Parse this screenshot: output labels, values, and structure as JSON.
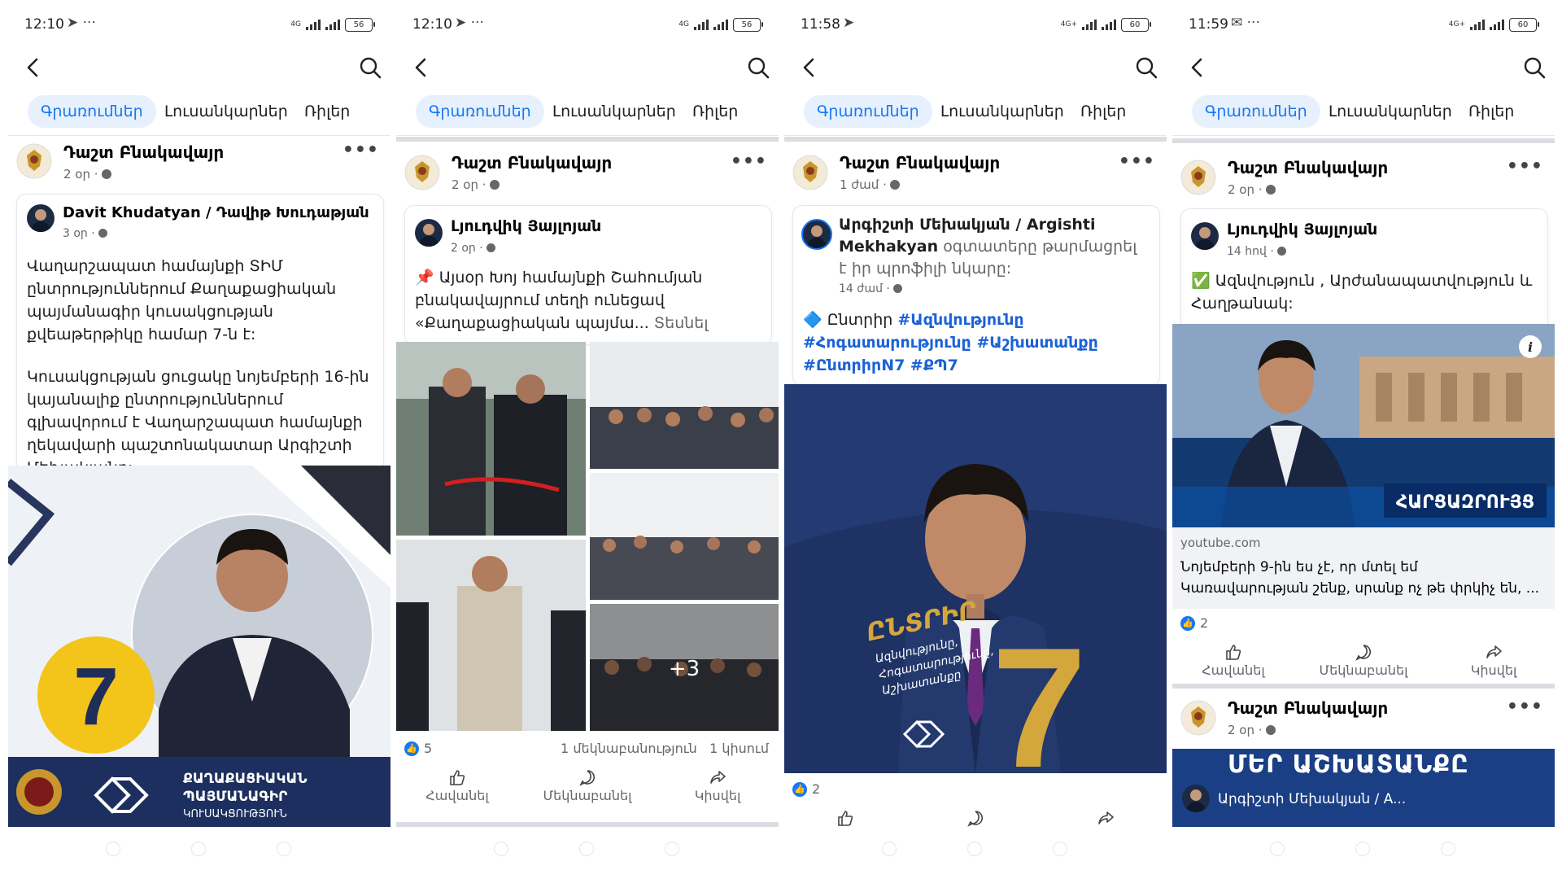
{
  "colors": {
    "accent": "#1877f2",
    "accent_bg": "#e7f0fd",
    "text": "#050505",
    "meta": "#65676b",
    "navy": "#1c2f5e",
    "gold": "#f1c40f"
  },
  "icons": [
    "back-icon",
    "search-icon",
    "globe-icon",
    "like-icon",
    "comment-icon",
    "share-icon",
    "more-icon"
  ],
  "tabs": [
    "Գրառումներ",
    "Լուսանկարներ",
    "Ռիլեր"
  ],
  "actions": [
    "Հավանել",
    "Մեկնաբանել",
    "Կիսվել"
  ],
  "page_name": "Դաշտ Բնակավայր",
  "screens": [
    {
      "status": {
        "time": "12:10",
        "extra": "➤ ···",
        "net": "4G",
        "battery": "56"
      },
      "post": {
        "meta": "2 օր ·",
        "shared_author": "Davit Khudatyan / Դավիթ Խուդաթյան",
        "shared_meta": "3 օր ·",
        "text_1": "Վաղարշապատ համայնքի ՏԻՄ ընտրություններում Քաղաքացիական պայմանագիր կուսակցության քվեաթերթիկը համար 7-ն է:",
        "text_2": "Կուսակցության ցուցակը նոյեմբերի 16-ին կայանալիք ընտրություններում գլխավորում է Վաղարշապատ համայնքի ղեկավարի պաշտոնակատար Արգիշտի Մեխակյանը:",
        "image_number": "7",
        "banner_line1": "ՔԱՂԱՔԱՑԻԱԿԱՆ",
        "banner_line2": "ՊԱՅՄԱՆԱԳԻՐ",
        "banner_line3": "ԿՈՒՍԱԿՑՈՒԹՅՈՒՆ"
      }
    },
    {
      "status": {
        "time": "12:10",
        "extra": "➤ ···",
        "net": "4G",
        "battery": "56"
      },
      "post": {
        "meta": "2 օր ·",
        "shared_author": "Լյուդվիկ Յայլոյան",
        "shared_meta": "2 օր ·",
        "text": "📌 Այսօր Խոյ համայնքի Շահումյան բնակավայրում  տեղի ունեցավ «Քաղաքացիական պայմա...",
        "see_more": "Տեսնել ավելին",
        "more_photos": "+3",
        "likes": "5",
        "comments": "1 մեկնաբանություն",
        "shares": "1 կիսում"
      }
    },
    {
      "status": {
        "time": "11:58",
        "extra": "➤",
        "net": "4G+",
        "battery": "60"
      },
      "post": {
        "meta": "1 ժամ ·",
        "shared_author": "Արգիշտի Մեխակյան / Argishti Mekhakyan",
        "shared_action": "օգտատերը թարմացրել է իր պրոֆիլի նկարը:",
        "shared_meta": "14 ժամ ·",
        "bullet": "🔷",
        "text_prefix": "Ընտրիր",
        "hashtags_1": "#Ազնվությունը",
        "hashtags_2": "#Հոգատարությունը #Աշխատանքը",
        "hashtags_3": "#ԸնտրիրN7 #ՔՊ7",
        "poster_title": "ԸՆՏՐԻՐ",
        "poster_line1": "Ազնվությունը,",
        "poster_line2": "Հոգատարությունը,",
        "poster_line3": "Աշխատանքը",
        "poster_number": "7",
        "likes": "2"
      }
    },
    {
      "status": {
        "time": "11:59",
        "extra": "✉ ···",
        "net": "4G+",
        "battery": "60"
      },
      "post": {
        "meta": "2 օր ·",
        "shared_author": "Լյուդվիկ Յայլոյան",
        "shared_meta": "14 հով ·",
        "text": "✅ Ազնվություն , Արժանապատվություն և Հաղթանակ:",
        "link_domain": "youtube.com",
        "link_title": "Նոյեմբերի 9-ին ես չէ, որ մտել եմ Կառավարության շենք, սրանք ոչ թե փրկիչ են, ...",
        "video_banner": "ՀԱՐՑԱԶՐՈՒՅՑ",
        "likes": "2",
        "next_meta": "2 օր ·",
        "next_banner": "ՄԵՐ ԱՇԽԱՏԱՆՔԸ",
        "next_sub": "Արգիշտի Մեխակյան / A..."
      }
    }
  ]
}
